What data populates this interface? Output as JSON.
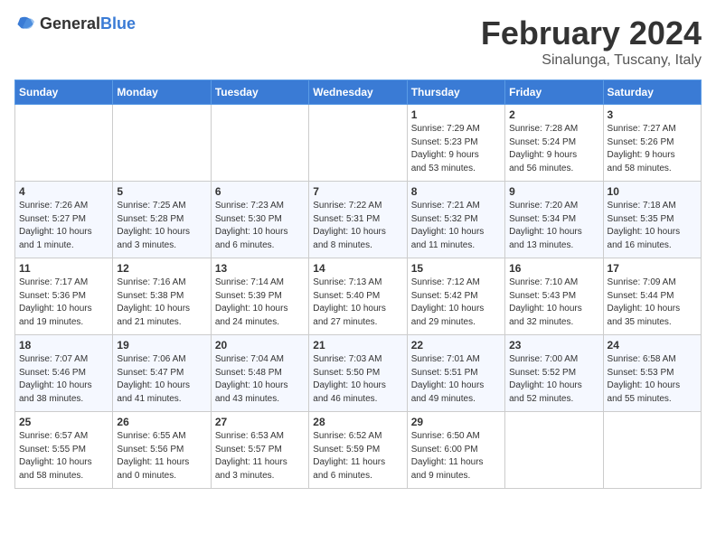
{
  "header": {
    "logo_general": "General",
    "logo_blue": "Blue",
    "month_title": "February 2024",
    "location": "Sinalunga, Tuscany, Italy"
  },
  "weekdays": [
    "Sunday",
    "Monday",
    "Tuesday",
    "Wednesday",
    "Thursday",
    "Friday",
    "Saturday"
  ],
  "weeks": [
    [
      {
        "day": "",
        "info": ""
      },
      {
        "day": "",
        "info": ""
      },
      {
        "day": "",
        "info": ""
      },
      {
        "day": "",
        "info": ""
      },
      {
        "day": "1",
        "info": "Sunrise: 7:29 AM\nSunset: 5:23 PM\nDaylight: 9 hours\nand 53 minutes."
      },
      {
        "day": "2",
        "info": "Sunrise: 7:28 AM\nSunset: 5:24 PM\nDaylight: 9 hours\nand 56 minutes."
      },
      {
        "day": "3",
        "info": "Sunrise: 7:27 AM\nSunset: 5:26 PM\nDaylight: 9 hours\nand 58 minutes."
      }
    ],
    [
      {
        "day": "4",
        "info": "Sunrise: 7:26 AM\nSunset: 5:27 PM\nDaylight: 10 hours\nand 1 minute."
      },
      {
        "day": "5",
        "info": "Sunrise: 7:25 AM\nSunset: 5:28 PM\nDaylight: 10 hours\nand 3 minutes."
      },
      {
        "day": "6",
        "info": "Sunrise: 7:23 AM\nSunset: 5:30 PM\nDaylight: 10 hours\nand 6 minutes."
      },
      {
        "day": "7",
        "info": "Sunrise: 7:22 AM\nSunset: 5:31 PM\nDaylight: 10 hours\nand 8 minutes."
      },
      {
        "day": "8",
        "info": "Sunrise: 7:21 AM\nSunset: 5:32 PM\nDaylight: 10 hours\nand 11 minutes."
      },
      {
        "day": "9",
        "info": "Sunrise: 7:20 AM\nSunset: 5:34 PM\nDaylight: 10 hours\nand 13 minutes."
      },
      {
        "day": "10",
        "info": "Sunrise: 7:18 AM\nSunset: 5:35 PM\nDaylight: 10 hours\nand 16 minutes."
      }
    ],
    [
      {
        "day": "11",
        "info": "Sunrise: 7:17 AM\nSunset: 5:36 PM\nDaylight: 10 hours\nand 19 minutes."
      },
      {
        "day": "12",
        "info": "Sunrise: 7:16 AM\nSunset: 5:38 PM\nDaylight: 10 hours\nand 21 minutes."
      },
      {
        "day": "13",
        "info": "Sunrise: 7:14 AM\nSunset: 5:39 PM\nDaylight: 10 hours\nand 24 minutes."
      },
      {
        "day": "14",
        "info": "Sunrise: 7:13 AM\nSunset: 5:40 PM\nDaylight: 10 hours\nand 27 minutes."
      },
      {
        "day": "15",
        "info": "Sunrise: 7:12 AM\nSunset: 5:42 PM\nDaylight: 10 hours\nand 29 minutes."
      },
      {
        "day": "16",
        "info": "Sunrise: 7:10 AM\nSunset: 5:43 PM\nDaylight: 10 hours\nand 32 minutes."
      },
      {
        "day": "17",
        "info": "Sunrise: 7:09 AM\nSunset: 5:44 PM\nDaylight: 10 hours\nand 35 minutes."
      }
    ],
    [
      {
        "day": "18",
        "info": "Sunrise: 7:07 AM\nSunset: 5:46 PM\nDaylight: 10 hours\nand 38 minutes."
      },
      {
        "day": "19",
        "info": "Sunrise: 7:06 AM\nSunset: 5:47 PM\nDaylight: 10 hours\nand 41 minutes."
      },
      {
        "day": "20",
        "info": "Sunrise: 7:04 AM\nSunset: 5:48 PM\nDaylight: 10 hours\nand 43 minutes."
      },
      {
        "day": "21",
        "info": "Sunrise: 7:03 AM\nSunset: 5:50 PM\nDaylight: 10 hours\nand 46 minutes."
      },
      {
        "day": "22",
        "info": "Sunrise: 7:01 AM\nSunset: 5:51 PM\nDaylight: 10 hours\nand 49 minutes."
      },
      {
        "day": "23",
        "info": "Sunrise: 7:00 AM\nSunset: 5:52 PM\nDaylight: 10 hours\nand 52 minutes."
      },
      {
        "day": "24",
        "info": "Sunrise: 6:58 AM\nSunset: 5:53 PM\nDaylight: 10 hours\nand 55 minutes."
      }
    ],
    [
      {
        "day": "25",
        "info": "Sunrise: 6:57 AM\nSunset: 5:55 PM\nDaylight: 10 hours\nand 58 minutes."
      },
      {
        "day": "26",
        "info": "Sunrise: 6:55 AM\nSunset: 5:56 PM\nDaylight: 11 hours\nand 0 minutes."
      },
      {
        "day": "27",
        "info": "Sunrise: 6:53 AM\nSunset: 5:57 PM\nDaylight: 11 hours\nand 3 minutes."
      },
      {
        "day": "28",
        "info": "Sunrise: 6:52 AM\nSunset: 5:59 PM\nDaylight: 11 hours\nand 6 minutes."
      },
      {
        "day": "29",
        "info": "Sunrise: 6:50 AM\nSunset: 6:00 PM\nDaylight: 11 hours\nand 9 minutes."
      },
      {
        "day": "",
        "info": ""
      },
      {
        "day": "",
        "info": ""
      }
    ]
  ]
}
